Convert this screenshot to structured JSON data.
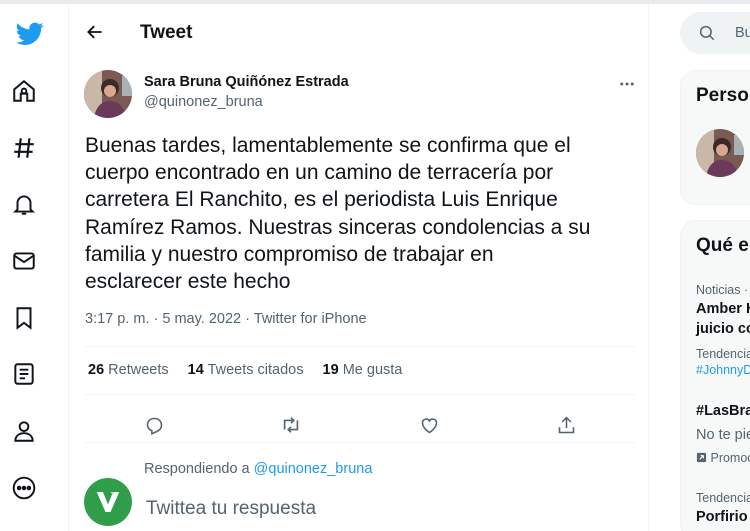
{
  "colors": {
    "accent": "#1d9bf0",
    "text": "#0f1419",
    "muted": "#536471",
    "reply_avatar": "#2f9d4a"
  },
  "nav": {
    "items": [
      "twitter-logo",
      "home-icon",
      "explore-hashtag-icon",
      "notifications-bell-icon",
      "messages-mail-icon",
      "bookmarks-icon",
      "lists-icon",
      "profile-icon",
      "more-circle-icon"
    ]
  },
  "header": {
    "title": "Tweet"
  },
  "tweet": {
    "author_name": "Sara Bruna Quiñónez Estrada",
    "author_handle": "@quinonez_bruna",
    "text": "Buenas tardes, lamentablemente se confirma que el\ncuerpo encontrado en un camino de terracería por\ncarretera El Ranchito,  es el periodista Luis Enrique\nRamírez Ramos. Nuestras sinceras condolencias a su\nfamilia y nuestro compromiso de trabajar en\nesclarecer este hecho",
    "time": "3:17 p. m.",
    "dot": "·",
    "date": "5 may. 2022",
    "source": "Twitter for iPhone",
    "stats": {
      "retweets_count": "26",
      "retweets_label": "Retweets",
      "quotes_count": "14",
      "quotes_label": "Tweets citados",
      "likes_count": "19",
      "likes_label": "Me gusta"
    }
  },
  "reply": {
    "replying_prefix": "Respondiendo a",
    "replying_handle": "@quinonez_bruna",
    "placeholder": "Twittea tu respuesta"
  },
  "sidebar": {
    "search_placeholder": "Bu",
    "card1_title": "Perso",
    "card2_title": "Qué e",
    "trends": [
      {
        "meta": "Noticias ·",
        "title": "Amber H",
        "title2": "juicio co"
      },
      {
        "meta": "Tendencia",
        "link": "#JohnnyD"
      },
      {
        "title": "#LasBra",
        "desc": "No te pie",
        "promo": "Promoc"
      },
      {
        "meta": "Tendencia",
        "title": "Porfirio"
      }
    ]
  }
}
